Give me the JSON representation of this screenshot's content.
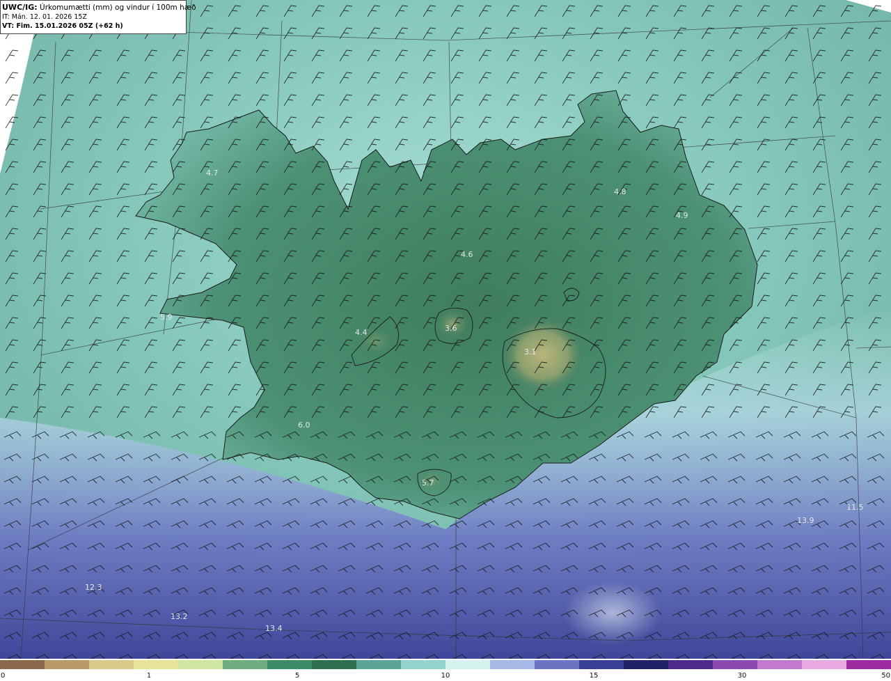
{
  "header": {
    "product_code": "UWC/IG:",
    "product_name": "Úrkomumætti (mm) og vindur í 100m hæð",
    "init_time": "IT: Mán. 12. 01. 2026 15Z",
    "valid_prefix": "VT:",
    "valid_time": "Fim. 15.01.2026 05Z (+62 h)"
  },
  "colors": {
    "land_low": "#2f6e4f",
    "land_high": "#b8b47a",
    "sea_near": "#9fd8d0",
    "sea_far": "#5a63b0",
    "deep": "#343c8a",
    "coastline": "#1a1a1a",
    "barb": "#111111"
  },
  "values": [
    {
      "id": "westfjords",
      "text": "4.7"
    },
    {
      "id": "north-central",
      "text": "4.6"
    },
    {
      "id": "northeast",
      "text": "4.8"
    },
    {
      "id": "east",
      "text": "4.9"
    },
    {
      "id": "west-plateau",
      "text": "4.4"
    },
    {
      "id": "langjokull",
      "text": "3.6"
    },
    {
      "id": "vatnajokull",
      "text": "3.1"
    },
    {
      "id": "snaefellsnes",
      "text": "5.9"
    },
    {
      "id": "reykjanes",
      "text": "6.0"
    },
    {
      "id": "myrdalsjokull",
      "text": "5.7"
    },
    {
      "id": "sea-southeast",
      "text": "13.9"
    },
    {
      "id": "sea-far-east",
      "text": "11.5"
    },
    {
      "id": "sea-sw-1",
      "text": "12.3"
    },
    {
      "id": "sea-sw-2",
      "text": "13.2"
    },
    {
      "id": "sea-sw-3",
      "text": "13.4"
    }
  ],
  "colorbar": {
    "ticks": [
      "0",
      "1",
      "5",
      "10",
      "15",
      "30",
      "50"
    ],
    "colors": [
      "#8a6a4a",
      "#b89a6a",
      "#d8c88a",
      "#e8e39a",
      "#cfe6a0",
      "#6fae80",
      "#3b8a68",
      "#2f6e4f",
      "#5aa596",
      "#93d5cc",
      "#d4f1ee",
      "#a6b8e6",
      "#6a74c2",
      "#3a3f96",
      "#1f2266",
      "#4e2a8a",
      "#8a4ab0",
      "#c27ad0",
      "#e8a8e0",
      "#9e2aa0"
    ]
  }
}
